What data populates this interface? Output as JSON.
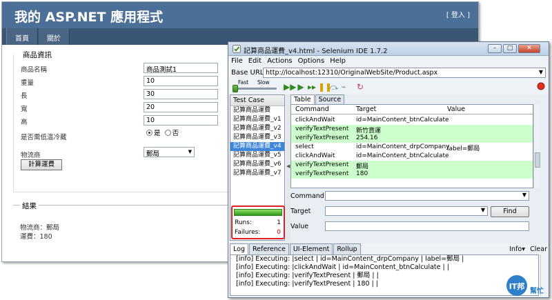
{
  "webpage": {
    "site_title": "我的 ASP.NET 應用程式",
    "login_link": "[ 登入 ]",
    "menu": [
      "首頁",
      "關於"
    ],
    "product_section_title": "商品資訊",
    "fields": {
      "name": {
        "label": "商品名稱",
        "value": "商品測試1"
      },
      "weight": {
        "label": "重量",
        "value": "10"
      },
      "length": {
        "label": "長",
        "value": "30"
      },
      "width": {
        "label": "寬",
        "value": "20"
      },
      "height": {
        "label": "高",
        "value": "10"
      }
    },
    "coolant": {
      "label": "是否需低溫冷藏",
      "yes": "是",
      "no": "否",
      "selected": "是"
    },
    "carrier": {
      "label": "物流商",
      "value": "郵局"
    },
    "calc_button": "計算運費",
    "result_title": "結果",
    "result_carrier": "物流商：郵局",
    "result_fee": "運費：180"
  },
  "selenium": {
    "title": "記算商品運費_v4.html - Selenium IDE 1.7.2",
    "menus": [
      "File",
      "Edit",
      "Actions",
      "Options",
      "Help"
    ],
    "base_url_label": "Base URL",
    "base_url": "http://localhost:12310/OriginalWebSite/Product.aspx",
    "speed_fast": "Fast",
    "speed_slow": "Slow",
    "test_case_header": "Test Case",
    "test_cases": [
      "記算商品運費",
      "記算商品運費_v1",
      "記算商品運費_v2",
      "記算商品運費_v3",
      "記算商品運費_v4",
      "記算商品運費_v5",
      "記算商品運費_v6",
      "記算商品運費_v7"
    ],
    "selected_test_case": "記算商品運費_v4",
    "runs_label": "Runs:",
    "runs_value": "1",
    "failures_label": "Failures:",
    "failures_value": "0",
    "progress_fraction": 1.0,
    "editor_tabs": [
      "Table",
      "Source"
    ],
    "table_headers": {
      "command": "Command",
      "target": "Target",
      "value": "Value"
    },
    "commands": [
      {
        "command": "clickAndWait",
        "target": "id=MainContent_btnCalculate",
        "value": "",
        "status": "plain"
      },
      {
        "command": "verifyTextPresent",
        "target": "新竹貨運",
        "value": "",
        "status": "ok"
      },
      {
        "command": "verifyTextPresent",
        "target": "254.16",
        "value": "",
        "status": "ok"
      },
      {
        "command": "select",
        "target": "id=MainContent_drpCompany",
        "value": "label=郵局",
        "status": "plain"
      },
      {
        "command": "clickAndWait",
        "target": "id=MainContent_btnCalculate",
        "value": "",
        "status": "plain"
      },
      {
        "command": "verifyTextPresent",
        "target": "郵局",
        "value": "",
        "status": "ok"
      },
      {
        "command": "verifyTextPresent",
        "target": "180",
        "value": "",
        "status": "ok"
      }
    ],
    "form_labels": {
      "command": "Command",
      "target": "Target",
      "value": "Value"
    },
    "find_button": "Find",
    "log_tabs": [
      "Log",
      "Reference",
      "UI-Element",
      "Rollup"
    ],
    "log_info": "Info▾",
    "log_clear": "Clear",
    "log_lines": [
      "[info] Executing: |select | id=MainContent_drpCompany | label=郵局 |",
      "[info] Executing: |clickAndWait | id=MainContent_btnCalculate | |",
      "[info] Executing: |verifyTextPresent | 郵局 | |",
      "[info] Executing: |verifyTextPresent | 180 | |"
    ]
  },
  "watermark": {
    "text_main": "IT邦",
    "text_sub": "幫忙"
  },
  "colors": {
    "header_bg": "#4b6f97",
    "menu_bg": "#3b5674",
    "pass_row": "#ccffcc",
    "selected_row": "#3d86d9",
    "highlight_box": "#e02020",
    "progress_green": "#2f9a17"
  }
}
